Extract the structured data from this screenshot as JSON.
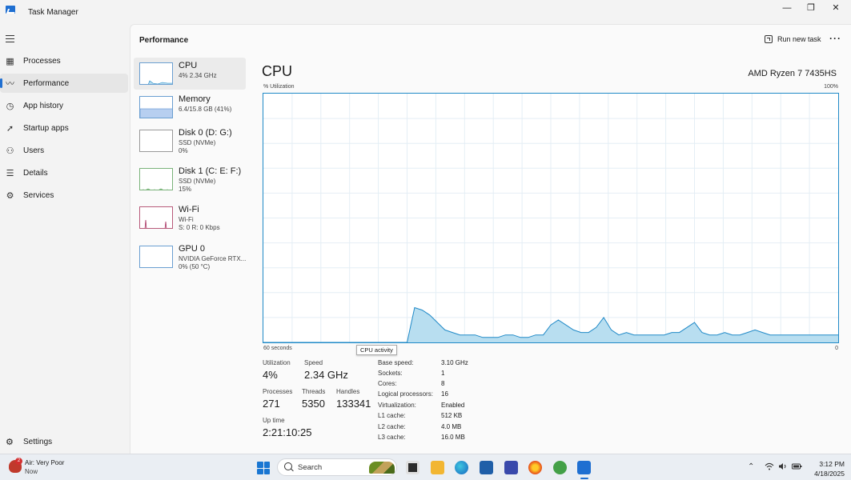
{
  "window": {
    "title": "Task Manager",
    "minimize_icon": "—",
    "maximize_icon": "❐",
    "close_icon": "✕"
  },
  "nav": {
    "items": [
      {
        "label": "Processes",
        "icon": "processes-icon"
      },
      {
        "label": "Performance",
        "icon": "performance-icon"
      },
      {
        "label": "App history",
        "icon": "app-history-icon"
      },
      {
        "label": "Startup apps",
        "icon": "startup-icon"
      },
      {
        "label": "Users",
        "icon": "users-icon"
      },
      {
        "label": "Details",
        "icon": "details-icon"
      },
      {
        "label": "Services",
        "icon": "services-icon"
      }
    ],
    "settings_label": "Settings"
  },
  "header": {
    "title": "Performance",
    "run_task_label": "Run new task",
    "more_label": "···"
  },
  "devices": [
    {
      "name": "CPU",
      "line1": "4%  2.34 GHz",
      "line2": ""
    },
    {
      "name": "Memory",
      "line1": "6.4/15.8 GB (41%)",
      "line2": ""
    },
    {
      "name": "Disk 0 (D: G:)",
      "line1": "SSD (NVMe)",
      "line2": "0%"
    },
    {
      "name": "Disk 1 (C: E: F:)",
      "line1": "SSD (NVMe)",
      "line2": "15%"
    },
    {
      "name": "Wi-Fi",
      "line1": "Wi-Fi",
      "line2": "S: 0 R: 0 Kbps"
    },
    {
      "name": "GPU 0",
      "line1": "NVIDIA GeForce RTX...",
      "line2": "0%  (50 °C)"
    }
  ],
  "detail": {
    "title": "CPU",
    "model": "AMD Ryzen 7 7435HS",
    "axis_top_left": "% Utilization",
    "axis_top_right": "100%",
    "axis_bottom_left": "60 seconds",
    "axis_bottom_right": "0",
    "tooltip": "CPU activity",
    "stats": {
      "utilization_label": "Utilization",
      "utilization": "4%",
      "speed_label": "Speed",
      "speed": "2.34 GHz",
      "processes_label": "Processes",
      "processes": "271",
      "threads_label": "Threads",
      "threads": "5350",
      "handles_label": "Handles",
      "handles": "133341",
      "uptime_label": "Up time",
      "uptime": "2:21:10:25"
    },
    "specs": [
      {
        "label": "Base speed:",
        "value": "3.10 GHz"
      },
      {
        "label": "Sockets:",
        "value": "1"
      },
      {
        "label": "Cores:",
        "value": "8"
      },
      {
        "label": "Logical processors:",
        "value": "16"
      },
      {
        "label": "Virtualization:",
        "value": "Enabled"
      },
      {
        "label": "L1 cache:",
        "value": "512 KB"
      },
      {
        "label": "L2 cache:",
        "value": "4.0 MB"
      },
      {
        "label": "L3 cache:",
        "value": "16.0 MB"
      }
    ]
  },
  "chart_data": {
    "type": "area",
    "ylim": [
      0,
      100
    ],
    "x_range_seconds": [
      60,
      0
    ],
    "values": [
      0,
      0,
      0,
      0,
      0,
      0,
      0,
      0,
      0,
      0,
      0,
      0,
      0,
      0,
      0,
      0,
      0,
      0,
      0,
      0,
      14,
      13,
      11,
      8,
      5,
      4,
      3,
      3,
      3,
      2,
      2,
      2,
      3,
      3,
      2,
      2,
      3,
      3,
      7,
      9,
      7,
      5,
      4,
      4,
      6,
      10,
      5,
      3,
      4,
      3,
      3,
      3,
      3,
      3,
      4,
      4,
      6,
      8,
      4,
      3,
      3,
      4,
      3,
      3,
      4,
      5,
      4,
      3,
      3,
      3,
      3,
      3,
      3,
      3,
      3,
      3,
      3
    ],
    "fill_color": "#b8def0",
    "line_color": "#1f89c7",
    "grid": true
  },
  "taskbar": {
    "weather_title": "Air: Very Poor",
    "weather_sub": "Now",
    "weather_badge": "2",
    "search_placeholder": "Search",
    "time": "3:12 PM",
    "date": "4/18/2025",
    "tray_chevron": "⌃",
    "wifi_icon": "wifi-icon",
    "volume_icon": "volume-icon",
    "battery_icon": "battery-icon"
  }
}
